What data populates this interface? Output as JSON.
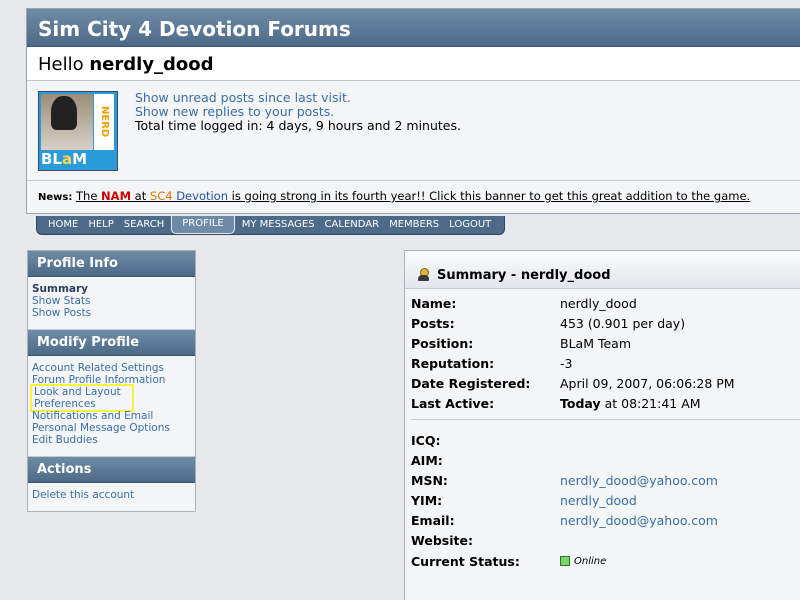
{
  "forum": {
    "title": "Sim City 4 Devotion Forums"
  },
  "user": {
    "greeting": "Hello",
    "name": "nerdly_dood",
    "avatar_text": {
      "nerd": "NERD",
      "brand_1": "BL",
      "brand_2": "a",
      "brand_3": "M"
    },
    "links": [
      "Show unread posts since last visit.",
      "Show new replies to your posts."
    ],
    "time_logged": "Total time logged in: 4 days, 9 hours and 2 minutes."
  },
  "news": {
    "label": "News:",
    "pre": "The ",
    "nam": "NAM",
    "at": " at ",
    "sc4": "SC4",
    "devotion": " Devotion",
    "rest": " is going strong in its fourth year!! Click this banner to get this great addition to the game."
  },
  "nav": [
    "HOME",
    "HELP",
    "SEARCH",
    "PROFILE",
    "MY MESSAGES",
    "CALENDAR",
    "MEMBERS",
    "LOGOUT"
  ],
  "sidebar": {
    "profile_info": {
      "title": "Profile Info",
      "items": [
        "Summary",
        "Show Stats",
        "Show Posts"
      ]
    },
    "modify_profile": {
      "title": "Modify Profile",
      "items": [
        "Account Related Settings",
        "Forum Profile Information",
        "Look and Layout",
        "Preferences",
        "Notifications and Email",
        "Personal Message Options",
        "Edit Buddies"
      ]
    },
    "actions": {
      "title": "Actions",
      "items": [
        "Delete this account"
      ]
    }
  },
  "summary": {
    "title": "Summary - nerdly_dood",
    "rows": [
      {
        "k": "Name:",
        "v": "nerdly_dood"
      },
      {
        "k": "Posts:",
        "v": "453 (0.901 per day)"
      },
      {
        "k": "Position:",
        "v": "BLaM Team"
      },
      {
        "k": "Reputation:",
        "v": "-3"
      },
      {
        "k": "Date Registered:",
        "v": "April 09, 2007, 06:06:28 PM"
      },
      {
        "k": "Last Active:",
        "v_bold": "Today",
        "v": " at 08:21:41 AM"
      }
    ],
    "contacts": [
      {
        "k": "ICQ:",
        "v": ""
      },
      {
        "k": "AIM:",
        "v": ""
      },
      {
        "k": "MSN:",
        "v": "nerdly_dood@yahoo.com"
      },
      {
        "k": "YIM:",
        "v": "nerdly_dood"
      },
      {
        "k": "Email:",
        "v": "nerdly_dood@yahoo.com"
      },
      {
        "k": "Website:",
        "v": ""
      }
    ],
    "status_label": "Current Status:",
    "status_value": "Online"
  }
}
